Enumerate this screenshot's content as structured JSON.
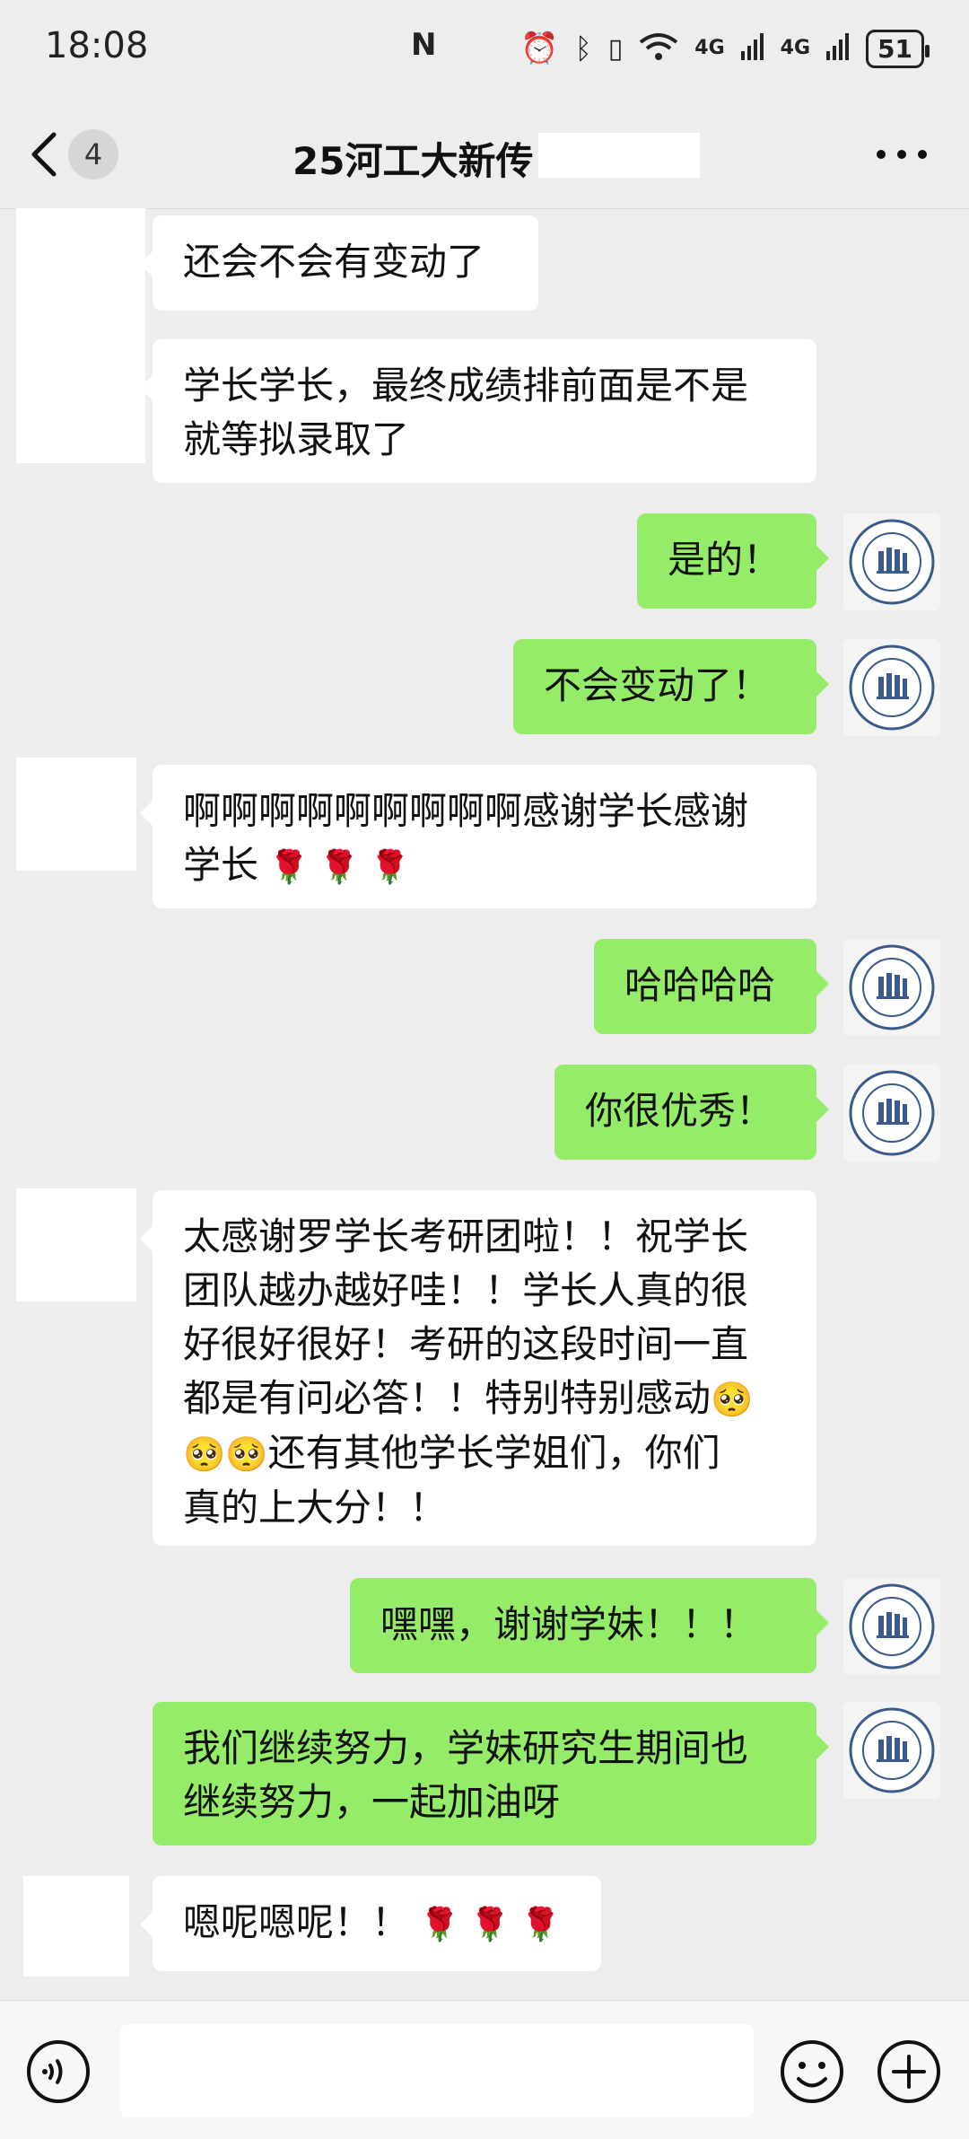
{
  "status_bar": {
    "time": "18:08",
    "signal1": "4G",
    "signal2": "4G",
    "battery": "51"
  },
  "header": {
    "unread_count": "4",
    "title": "25河工大新传"
  },
  "messages": [
    {
      "side": "left",
      "text": "还会不会有变动了"
    },
    {
      "side": "left",
      "lines": [
        "学长学长，最终成绩排前面是不是",
        "就等拟录取了"
      ]
    },
    {
      "side": "right",
      "text": "是的！"
    },
    {
      "side": "right",
      "text": "不会变动了！"
    },
    {
      "side": "left",
      "lines": [
        "啊啊啊啊啊啊啊啊啊感谢学长感谢",
        "学长"
      ],
      "emoji": "rose-emoji"
    },
    {
      "side": "right",
      "text": "哈哈哈哈"
    },
    {
      "side": "right",
      "text": "你很优秀！"
    },
    {
      "side": "left",
      "lines": [
        "太感谢罗学长考研团啦！！祝学长",
        "团队越办越好哇！！学长人真的很",
        "好很好很好！考研的这段时间一直",
        "都是有问必答！！特别特别感动",
        "还有其他学长学姐们，你们",
        "真的上大分！！"
      ],
      "emoji": "pleading-face-emoji"
    },
    {
      "side": "right",
      "text": "嘿嘿，谢谢学妹！！！"
    },
    {
      "side": "right",
      "lines": [
        "我们继续努力，学妹研究生期间也",
        "继续努力，一起加油呀"
      ]
    },
    {
      "side": "left",
      "text": "嗯呢嗯呢！！",
      "emoji": "rose-emoji"
    }
  ],
  "colors": {
    "background": "#ededed",
    "sent_bubble": "#95ec69",
    "received_bubble": "#ffffff"
  }
}
